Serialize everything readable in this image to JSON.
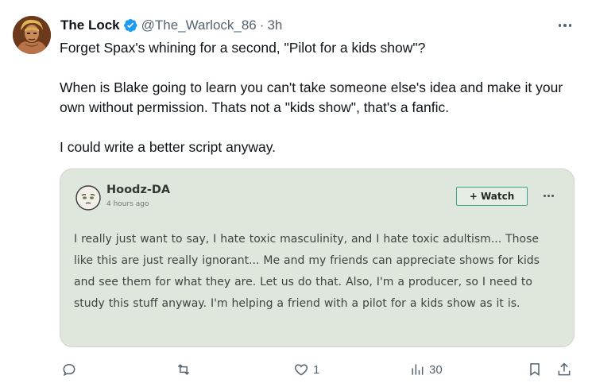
{
  "post": {
    "display_name": "The Lock",
    "handle": "@The_Warlock_86",
    "separator": "·",
    "time": "3h",
    "paragraphs": [
      "Forget Spax's whining for a second, \"Pilot for a kids show\"?",
      "When is Blake going to learn you can't take someone else's idea and make it your own without permission. Thats not a \"kids show\", that's a fanfic.",
      "I could write a better script anyway."
    ]
  },
  "quote": {
    "name": "Hoodz-DA",
    "time": "4 hours ago",
    "watch_label": "+ Watch",
    "body": "I really just want to say, I hate toxic masculinity, and I hate toxic adultism... Those like this are just really ignorant...  Me and my friends can appreciate shows for kids and see them for what they are.  Let us do that.  Also, I'm a producer, so I need to study this stuff anyway.  I'm helping a friend with a pilot for a kids show as it is."
  },
  "actions": {
    "reply_count": "",
    "repost_count": "",
    "like_count": "1",
    "views_count": "30"
  },
  "icons": {
    "verified": "verified-badge-icon",
    "more": "more-icon",
    "reply": "reply-icon",
    "repost": "repost-icon",
    "like": "heart-icon",
    "views": "views-icon",
    "bookmark": "bookmark-icon",
    "share": "share-icon"
  },
  "colors": {
    "verified_blue": "#1d9bf0",
    "quote_background": "#dfe6dc",
    "watch_border": "#3fa58a",
    "secondary_text": "#536471"
  }
}
